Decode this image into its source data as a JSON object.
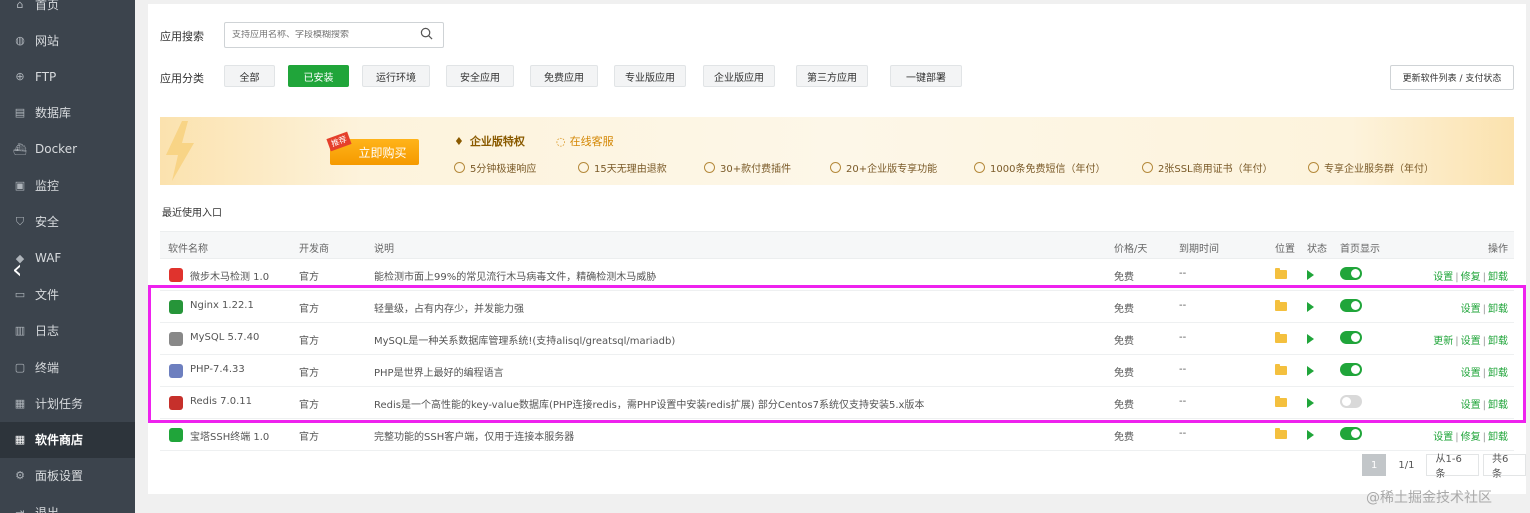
{
  "sidebar": {
    "items": [
      {
        "label": "首页",
        "icon": "home-icon",
        "glyph": "⌂",
        "active": false
      },
      {
        "label": "网站",
        "icon": "globe-icon",
        "glyph": "◍",
        "active": false
      },
      {
        "label": "FTP",
        "icon": "ftp-icon",
        "glyph": "⊕",
        "active": false
      },
      {
        "label": "数据库",
        "icon": "database-icon",
        "glyph": "▤",
        "active": false
      },
      {
        "label": "Docker",
        "icon": "docker-icon",
        "glyph": "⛴",
        "active": false
      },
      {
        "label": "监控",
        "icon": "monitor-icon",
        "glyph": "▣",
        "active": false
      },
      {
        "label": "安全",
        "icon": "shield-icon",
        "glyph": "⛉",
        "active": false
      },
      {
        "label": "WAF",
        "icon": "waf-icon",
        "glyph": "◆",
        "active": false
      },
      {
        "label": "文件",
        "icon": "folder-icon",
        "glyph": "▭",
        "active": false
      },
      {
        "label": "日志",
        "icon": "log-icon",
        "glyph": "▥",
        "active": false
      },
      {
        "label": "终端",
        "icon": "terminal-icon",
        "glyph": "▢",
        "active": false
      },
      {
        "label": "计划任务",
        "icon": "calendar-icon",
        "glyph": "▦",
        "active": false
      },
      {
        "label": "软件商店",
        "icon": "grid-icon",
        "glyph": "▦",
        "active": true
      },
      {
        "label": "面板设置",
        "icon": "gear-icon",
        "glyph": "⚙",
        "active": false
      },
      {
        "label": "退出",
        "icon": "logout-icon",
        "glyph": "⇥",
        "active": false
      }
    ],
    "collapse_glyph": "‹"
  },
  "search": {
    "label": "应用搜索",
    "placeholder": "支持应用名称、字段模糊搜索"
  },
  "categories": {
    "label": "应用分类",
    "items": [
      "全部",
      "已安装",
      "运行环境",
      "安全应用",
      "免费应用",
      "专业版应用",
      "企业版应用",
      "第三方应用",
      "一键部署"
    ],
    "active_index": 1
  },
  "update_button": "更新软件列表 / 支付状态",
  "banner": {
    "badge": "推荐",
    "buy_label": "立即购买",
    "title": "企业版特权",
    "service": "在线客服",
    "features": [
      "5分钟极速响应",
      "15天无理由退款",
      "30+款付费插件",
      "20+企业版专享功能",
      "1000条免费短信（年付）",
      "2张SSL商用证书（年付）",
      "专享企业服务群（年付）"
    ]
  },
  "recent_label": "最近使用入口",
  "table": {
    "headers": {
      "name": "软件名称",
      "dev": "开发商",
      "desc": "说明",
      "price": "价格/天",
      "expire": "到期时间",
      "location": "位置",
      "status": "状态",
      "home": "首页显示",
      "ops": "操作"
    },
    "rows": [
      {
        "name": "微步木马检测 1.0",
        "dev": "官方",
        "desc": "能检测市面上99%的常见流行木马病毒文件，精确检测木马威胁",
        "price": "免费",
        "expire": "--",
        "home_on": true,
        "ops": [
          "设置",
          "修复",
          "卸载"
        ],
        "icon": "threatbook-icon",
        "color": "#e0332d"
      },
      {
        "name": "Nginx 1.22.1",
        "dev": "官方",
        "desc": "轻量级，占有内存少，并发能力强",
        "price": "免费",
        "expire": "--",
        "home_on": true,
        "ops": [
          "设置",
          "卸载"
        ],
        "icon": "nginx-icon",
        "color": "#269539"
      },
      {
        "name": "MySQL 5.7.40",
        "dev": "官方",
        "desc": "MySQL是一种关系数据库管理系统!(支持alisql/greatsql/mariadb)",
        "price": "免费",
        "expire": "--",
        "home_on": true,
        "ops": [
          "更新",
          "设置",
          "卸载"
        ],
        "icon": "mysql-icon",
        "color": "#888888"
      },
      {
        "name": "PHP-7.4.33",
        "dev": "官方",
        "desc": "PHP是世界上最好的编程语言",
        "price": "免费",
        "expire": "--",
        "home_on": true,
        "ops": [
          "设置",
          "卸载"
        ],
        "icon": "php-icon",
        "color": "#6d7fbf"
      },
      {
        "name": "Redis 7.0.11",
        "dev": "官方",
        "desc": "Redis是一个高性能的key-value数据库(PHP连接redis，需PHP设置中安装redis扩展) 部分Centos7系统仅支持安装5.x版本",
        "price": "免费",
        "expire": "--",
        "home_on": false,
        "ops": [
          "设置",
          "卸载"
        ],
        "icon": "redis-icon",
        "color": "#c6302b"
      },
      {
        "name": "宝塔SSH终端 1.0",
        "dev": "官方",
        "desc": "完整功能的SSH客户端，仅用于连接本服务器",
        "price": "免费",
        "expire": "--",
        "home_on": true,
        "ops": [
          "设置",
          "修复",
          "卸载"
        ],
        "icon": "ssh-terminal-icon",
        "color": "#20a53a"
      }
    ]
  },
  "pagination": {
    "current": "1",
    "pages": "1/1",
    "range": "从1-6条",
    "total": "共6条"
  },
  "watermark": "@稀土掘金技术社区",
  "colors": {
    "accent": "#20a53a",
    "sidebar_bg": "#3c444d",
    "highlight": "#ee22ee"
  }
}
